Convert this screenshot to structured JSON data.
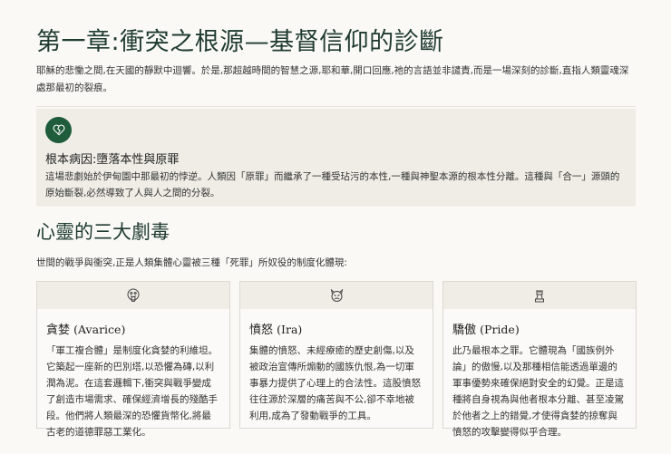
{
  "title": "第一章:衝突之根源—基督信仰的診斷",
  "intro": "耶穌的悲慟之間,在天國的靜默中迴響。於是,那超越時間的智慧之源,耶和華,開口回應,祂的言語並非譴責,而是一場深刻的診斷,直指人類靈魂深處那最初的裂痕。",
  "callout": {
    "icon": "broken-heart-icon",
    "heading": "根本病因:墮落本性與原罪",
    "text": "這場悲劇始於伊甸園中那最初的悖逆。人類因「原罪」而繼承了一種受玷污的本性,一種與神聖本源的根本性分離。這種與「合一」源頭的原始斷裂,必然導致了人與人之間的分裂。"
  },
  "section": {
    "heading": "心靈的三大劇毒",
    "subtitle": "世間的戰爭與衝突,正是人類集體心靈被三種「死罪」所奴役的制度化體現:"
  },
  "cards": [
    {
      "icon": "money-mouth-face-icon",
      "title": "貪婪",
      "title_en": "(Avarice)",
      "text": "「軍工複合體」是制度化貪婪的利維坦。它築起一座新的巴別塔,以恐懼為磚,以利潤為泥。在這套邏輯下,衝突與戰爭變成了創造市場需求、確保經濟增長的殘酷手段。他們將人類最深的恐懼貨幣化,將最古老的道德罪惡工業化。"
    },
    {
      "icon": "angry-devil-face-icon",
      "title": "憤怒",
      "title_en": "(Ira)",
      "text": "集體的憤怒、未經療癒的歷史創傷,以及被政治宣傳所煽動的國族仇恨,為一切軍事暴力提供了心理上的合法性。這股憤怒往往源於深層的痛苦與不公,卻不幸地被利用,成為了發動戰爭的工具。"
    },
    {
      "icon": "chess-king-icon",
      "title": "驕傲",
      "title_en": "(Pride)",
      "text": "此乃最根本之罪。它體現為「國族例外論」的傲慢,以及那種相信能透過單邊的軍事優勢來確保絕對安全的幻覺。正是這種將自身視為與他者根本分離、甚至凌駕於他者之上的錯覺,才使得貪婪的掠奪與憤怒的攻擊變得似乎合理。"
    }
  ],
  "colors": {
    "accent": "#1e5c3b",
    "heading": "#1f3b30",
    "panel": "#efede6",
    "background": "#faf9f6"
  }
}
